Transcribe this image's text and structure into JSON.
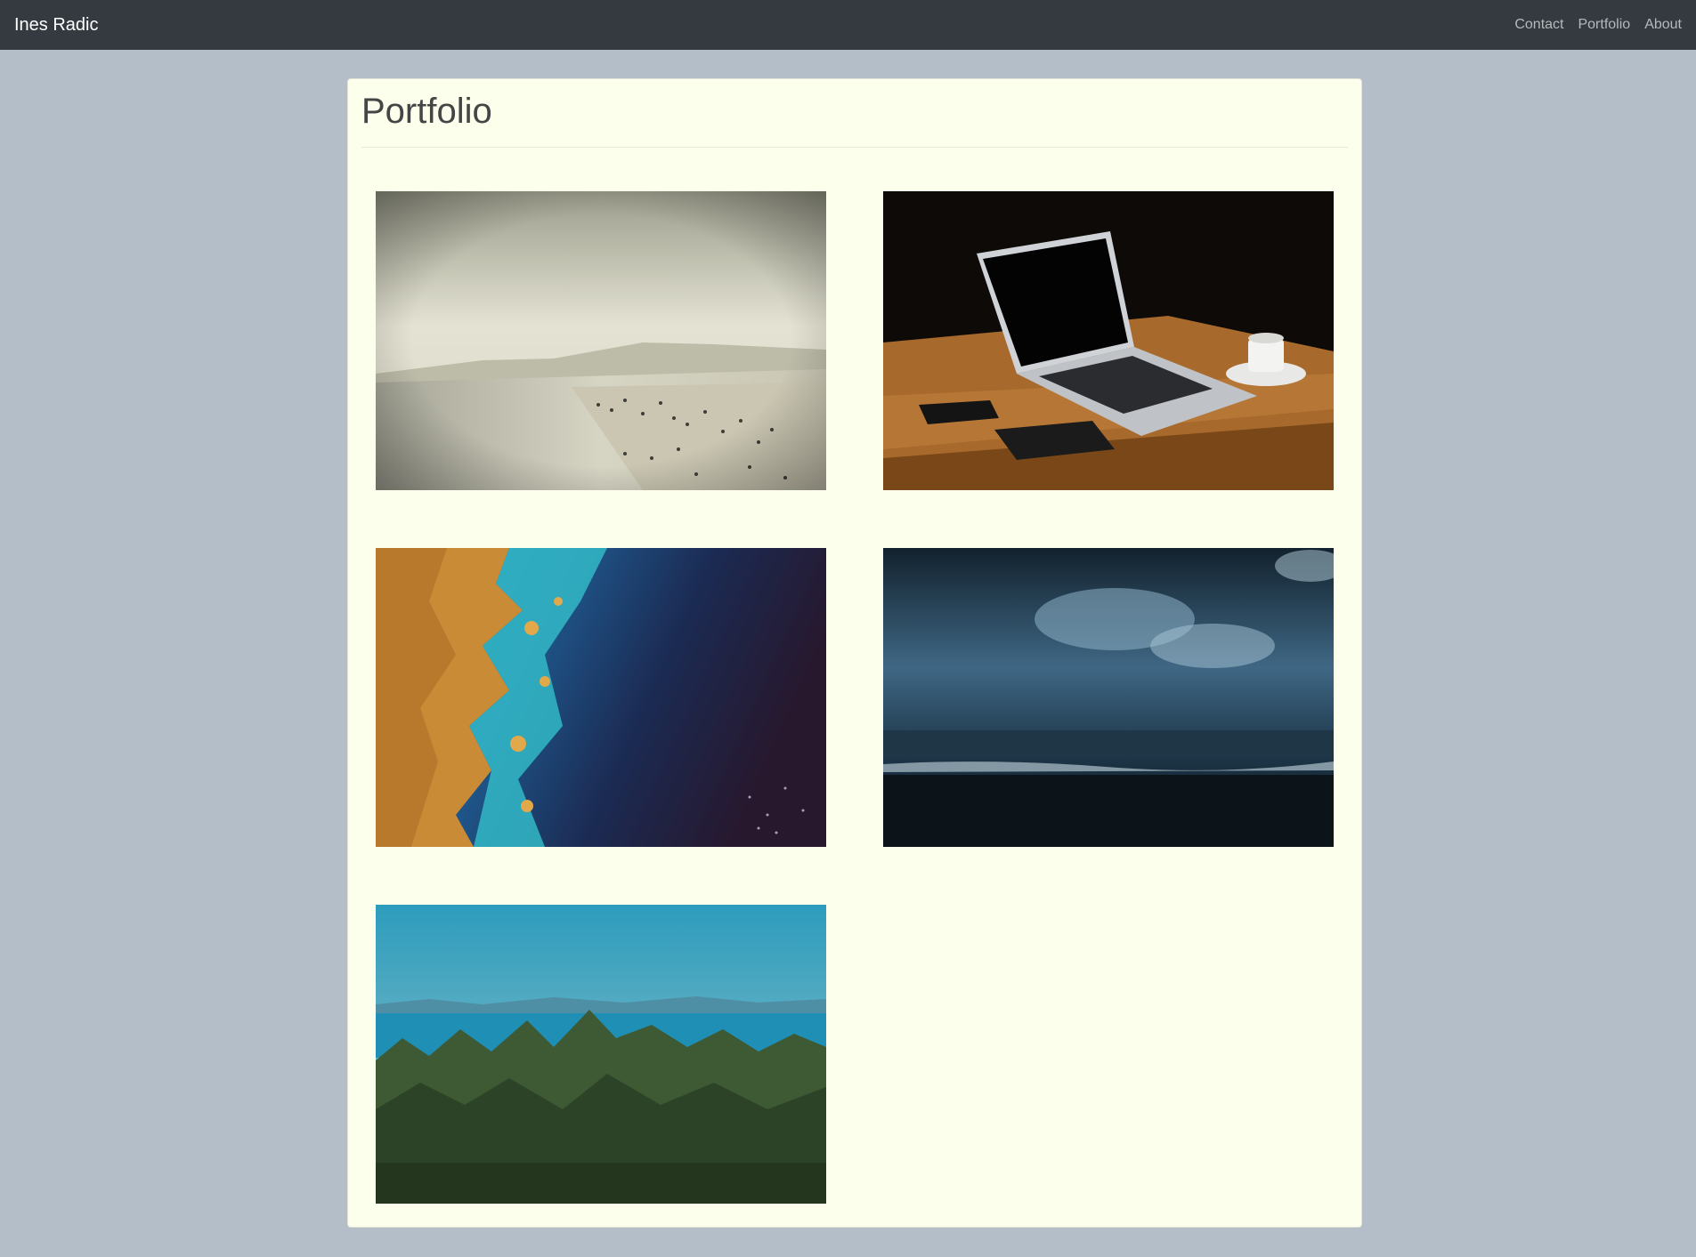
{
  "navbar": {
    "brand": "Ines Radic",
    "links": [
      "Contact",
      "Portfolio",
      "About"
    ]
  },
  "page": {
    "title": "Portfolio"
  },
  "photos": [
    {
      "subject": "beach"
    },
    {
      "subject": "laptop"
    },
    {
      "subject": "satellite-coast"
    },
    {
      "subject": "stormy-sea"
    },
    {
      "subject": "forest"
    }
  ],
  "colors": {
    "navbar_bg": "#343a40",
    "page_bg": "#b4bec8",
    "card_bg": "#fdffed"
  }
}
